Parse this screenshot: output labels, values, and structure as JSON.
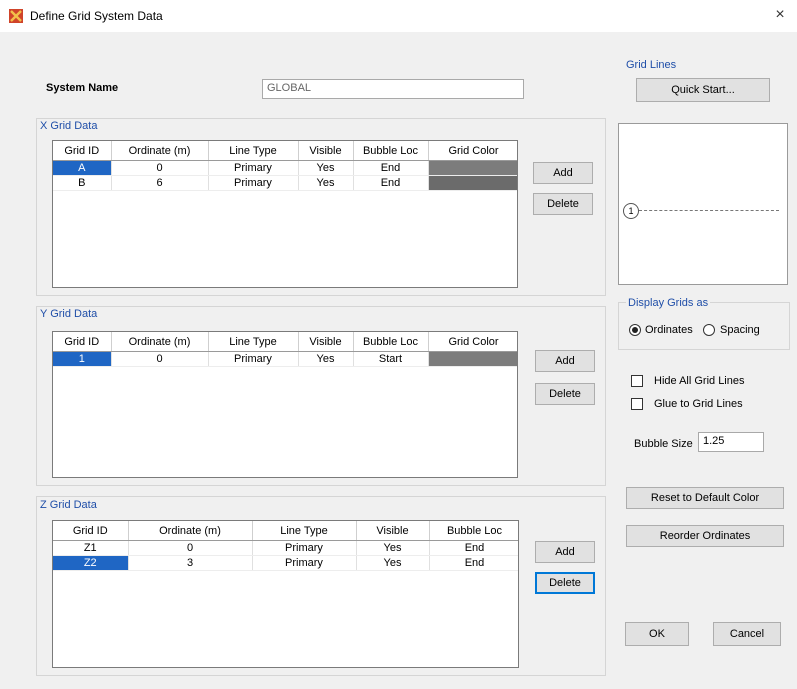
{
  "window": {
    "title": "Define Grid System Data",
    "close_glyph": "×"
  },
  "system": {
    "name_label": "System Name",
    "name_value": "GLOBAL"
  },
  "x_grid": {
    "label": "X Grid Data",
    "columns": [
      "Grid ID",
      "Ordinate (m)",
      "Line Type",
      "Visible",
      "Bubble Loc",
      "Grid Color"
    ],
    "rows": [
      {
        "id": "A",
        "ordinate": "0",
        "line_type": "Primary",
        "visible": "Yes",
        "bubble": "End",
        "selected": true
      },
      {
        "id": "B",
        "ordinate": "6",
        "line_type": "Primary",
        "visible": "Yes",
        "bubble": "End",
        "selected": false
      }
    ],
    "add_label": "Add",
    "delete_label": "Delete"
  },
  "y_grid": {
    "label": "Y Grid Data",
    "columns": [
      "Grid ID",
      "Ordinate (m)",
      "Line Type",
      "Visible",
      "Bubble Loc",
      "Grid Color"
    ],
    "rows": [
      {
        "id": "1",
        "ordinate": "0",
        "line_type": "Primary",
        "visible": "Yes",
        "bubble": "Start",
        "selected": true
      }
    ],
    "add_label": "Add",
    "delete_label": "Delete"
  },
  "z_grid": {
    "label": "Z Grid Data",
    "columns": [
      "Grid ID",
      "Ordinate (m)",
      "Line Type",
      "Visible",
      "Bubble Loc"
    ],
    "rows": [
      {
        "id": "Z1",
        "ordinate": "0",
        "line_type": "Primary",
        "visible": "Yes",
        "bubble": "End",
        "selected": false
      },
      {
        "id": "Z2",
        "ordinate": "3",
        "line_type": "Primary",
        "visible": "Yes",
        "bubble": "End",
        "selected": true
      }
    ],
    "add_label": "Add",
    "delete_label": "Delete"
  },
  "grid_lines": {
    "label": "Grid Lines",
    "quick_start_label": "Quick Start...",
    "preview_bubble": "1"
  },
  "display": {
    "label": "Display Grids as",
    "ordinates_label": "Ordinates",
    "spacing_label": "Spacing",
    "selected": "ordinates"
  },
  "options": {
    "hide_all_label": "Hide All Grid Lines",
    "glue_label": "Glue to Grid Lines",
    "bubble_size_label": "Bubble Size",
    "bubble_size_value": "1.25"
  },
  "buttons": {
    "reset_color": "Reset to Default Color",
    "reorder": "Reorder Ordinates",
    "ok": "OK",
    "cancel": "Cancel"
  },
  "colors": {
    "selection": "#1f66c4",
    "grid_color": "#7c7c7c",
    "section_label": "#1f4ea8"
  }
}
